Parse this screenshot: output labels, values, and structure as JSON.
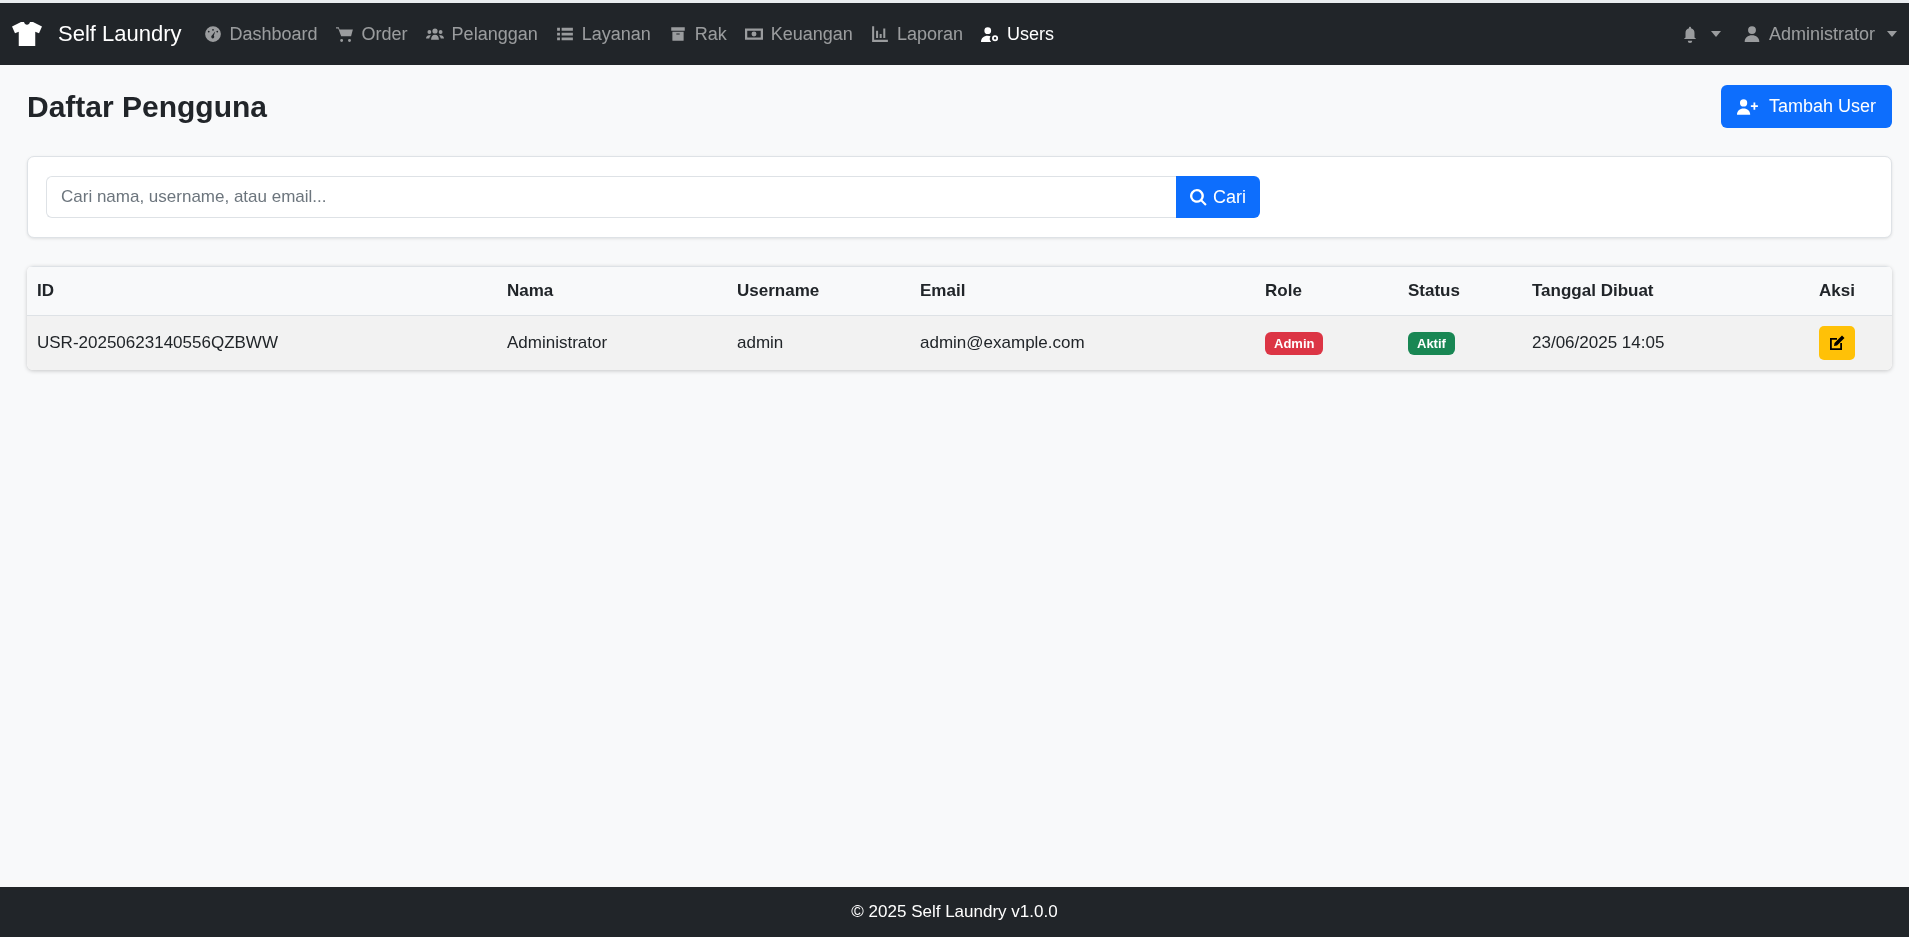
{
  "navbar": {
    "brand": "Self Laundry",
    "items": [
      {
        "label": "Dashboard",
        "selected": false
      },
      {
        "label": "Order",
        "selected": false
      },
      {
        "label": "Pelanggan",
        "selected": false
      },
      {
        "label": "Layanan",
        "selected": false
      },
      {
        "label": "Rak",
        "selected": false
      },
      {
        "label": "Keuangan",
        "selected": false
      },
      {
        "label": "Laporan",
        "selected": false
      },
      {
        "label": "Users",
        "selected": true
      }
    ],
    "user": "Administrator"
  },
  "page_title": "Daftar Pengguna",
  "add_button": "Tambah User",
  "search": {
    "placeholder": "Cari nama, username, atau email...",
    "button": "Cari"
  },
  "table": {
    "columns": [
      "ID",
      "Nama",
      "Username",
      "Email",
      "Role",
      "Status",
      "Tanggal Dibuat",
      "Aksi"
    ],
    "rows": [
      {
        "id": "USR-20250623140556QZBWW",
        "nama": "Administrator",
        "username": "admin",
        "email": "admin@example.com",
        "role": {
          "text": "Admin",
          "color": "#dc3545"
        },
        "status": {
          "text": "Aktif",
          "color": "#198754"
        },
        "created": "23/06/2025 14:05"
      }
    ]
  },
  "footer": "© 2025 Self Laundry v1.0.0"
}
